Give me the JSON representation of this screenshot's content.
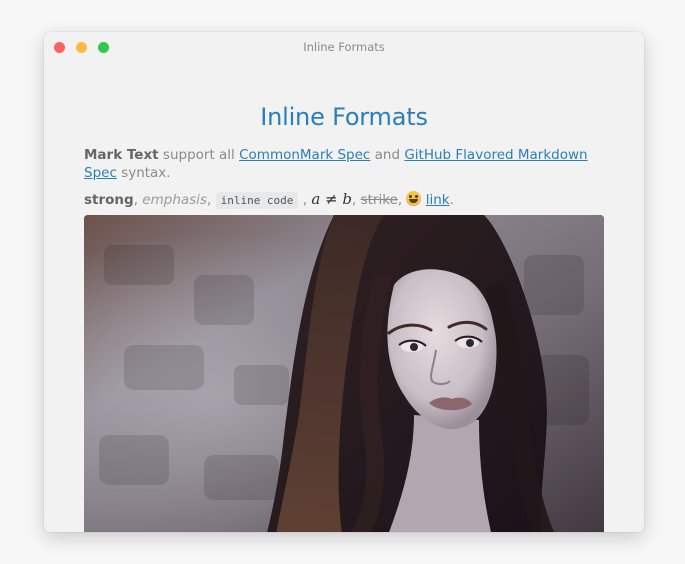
{
  "window": {
    "title": "Inline Formats",
    "controls": [
      "close",
      "minimize",
      "maximize"
    ]
  },
  "document": {
    "heading": "Inline Formats",
    "paragraph1": {
      "strong": "Mark Text",
      "text1": " support all ",
      "link1": "CommonMark Spec",
      "text2": " and ",
      "link2": "GitHub Flavored Markdown Spec",
      "text3": " syntax."
    },
    "paragraph2": {
      "strong": "strong",
      "sep1": ", ",
      "emphasis": "emphasis",
      "sep2": ", ",
      "code": "inline code",
      "sep3": " , ",
      "math": "a ≠ b",
      "sep4": ", ",
      "strike": "strike",
      "sep5": ", ",
      "emoji": "grinning-face",
      "sep6": " ",
      "link": "link",
      "sep7": "."
    },
    "image": {
      "subject": "portrait of a woman with long dark hair against a stone wall"
    }
  },
  "colors": {
    "heading": "#2a7fb8",
    "link": "#2a7fb8",
    "text": "#8a8a8a",
    "window_bg": "#f2f2f2",
    "close": "#fc615d",
    "minimize": "#fdbc40",
    "maximize": "#34c84a"
  }
}
